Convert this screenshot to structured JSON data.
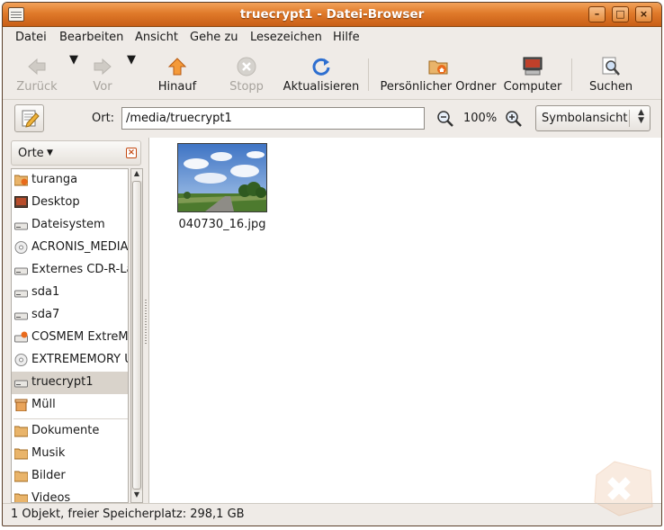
{
  "window": {
    "title": "truecrypt1 - Datei-Browser"
  },
  "menu": [
    {
      "label": "Datei"
    },
    {
      "label": "Bearbeiten"
    },
    {
      "label": "Ansicht"
    },
    {
      "label": "Gehe zu"
    },
    {
      "label": "Lesezeichen"
    },
    {
      "label": "Hilfe"
    }
  ],
  "toolbar": {
    "back": "Zurück",
    "forward": "Vor",
    "up": "Hinauf",
    "stop": "Stopp",
    "reload": "Aktualisieren",
    "home": "Persönlicher Ordner",
    "computer": "Computer",
    "search": "Suchen"
  },
  "location": {
    "label": "Ort:",
    "path": "/media/truecrypt1",
    "zoom": "100%",
    "view_mode": "Symbolansicht"
  },
  "sidebar": {
    "header": "Orte",
    "items": [
      {
        "label": "turanga",
        "icon": "home-folder-icon"
      },
      {
        "label": "Desktop",
        "icon": "desktop-icon"
      },
      {
        "label": "Dateisystem",
        "icon": "drive-icon"
      },
      {
        "label": "ACRONIS_MEDIA",
        "icon": "cdrom-icon"
      },
      {
        "label": "Externes CD-R-La",
        "icon": "drive-icon"
      },
      {
        "label": "sda1",
        "icon": "drive-icon"
      },
      {
        "label": "sda7",
        "icon": "drive-icon"
      },
      {
        "label": "COSMEM ExtreMI",
        "icon": "removable-drive-icon"
      },
      {
        "label": "EXTREMEMORY U",
        "icon": "cdrom-icon"
      },
      {
        "label": "truecrypt1",
        "icon": "drive-icon",
        "selected": true
      },
      {
        "label": "Müll",
        "icon": "trash-icon"
      }
    ],
    "bookmarks": [
      {
        "label": "Dokumente",
        "icon": "folder-icon"
      },
      {
        "label": "Musik",
        "icon": "folder-icon"
      },
      {
        "label": "Bilder",
        "icon": "folder-icon"
      },
      {
        "label": "Videos",
        "icon": "folder-icon"
      }
    ]
  },
  "files": [
    {
      "name": "040730_16.jpg"
    }
  ],
  "status": "1 Objekt, freier Speicherplatz: 298,1 GB",
  "colors": {
    "titlebar": "#e07a2a",
    "selection": "#d9d3cb",
    "window_bg": "#efebe7"
  }
}
